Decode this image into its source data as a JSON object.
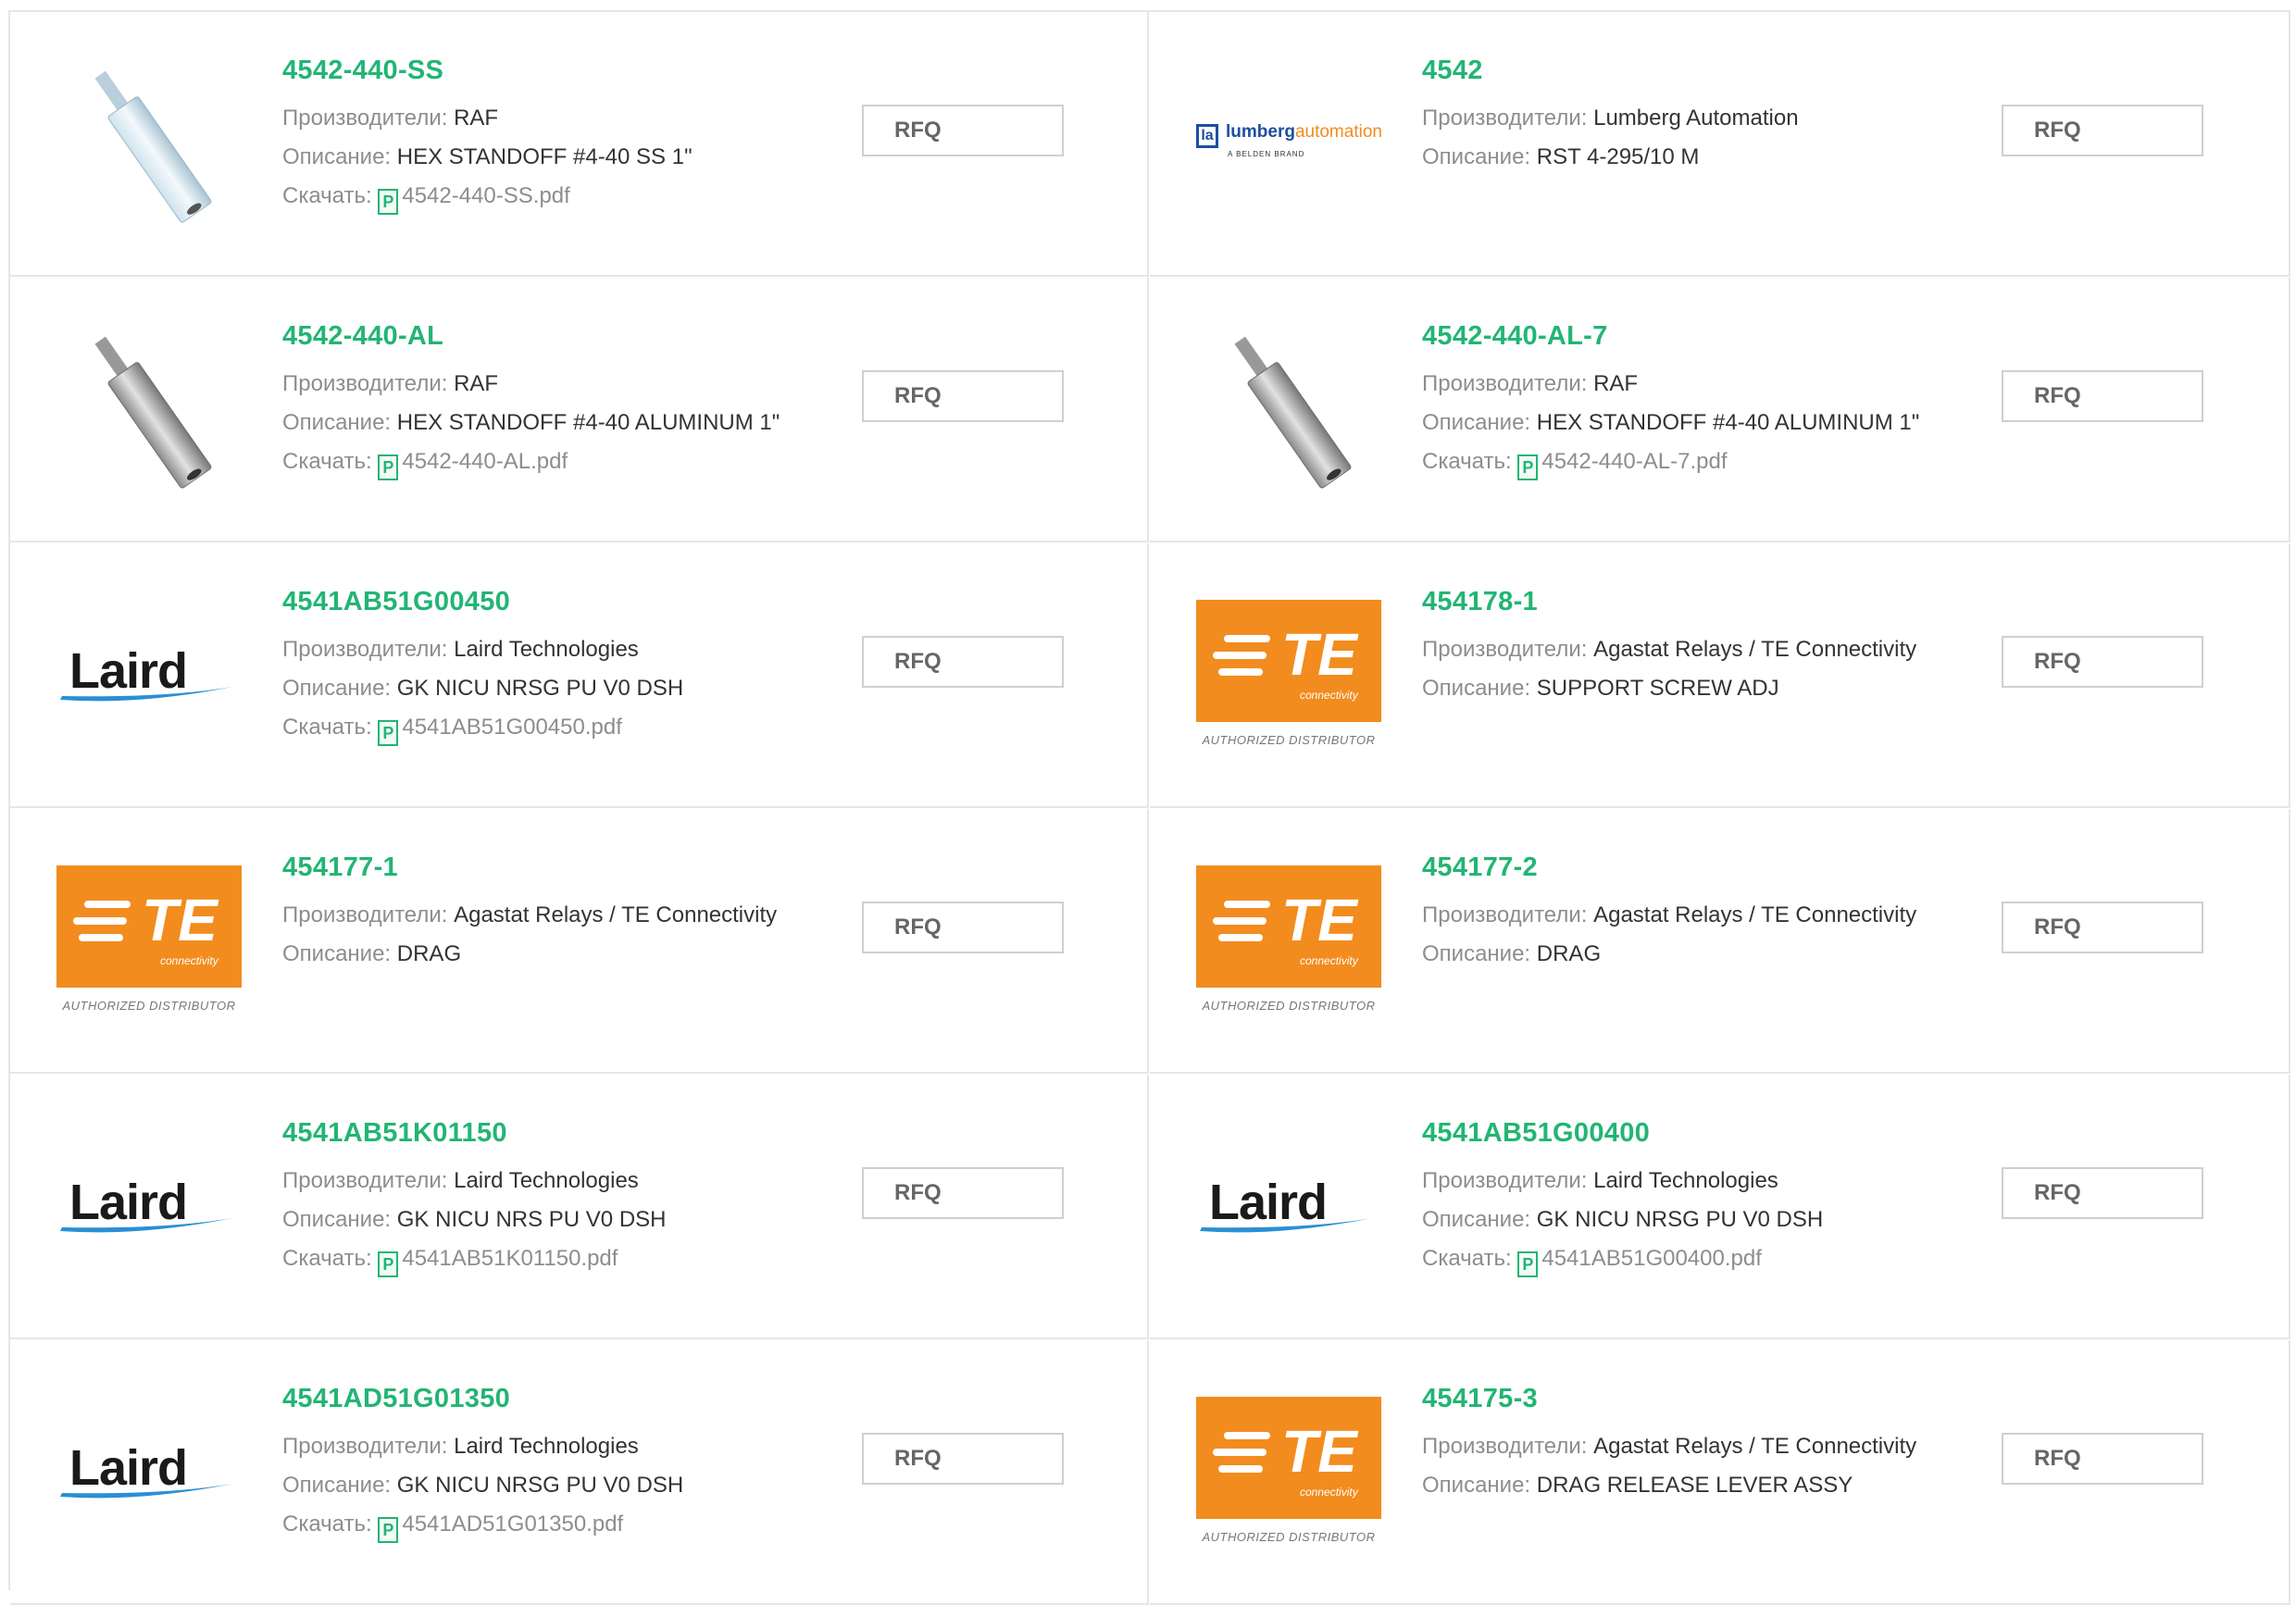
{
  "labels": {
    "manufacturer": "Производители:",
    "description": "Описание:",
    "download": "Скачать:",
    "rfq": "RFQ",
    "pdf_icon_glyph": "P"
  },
  "logos": {
    "laird": "Laird",
    "te": "TE",
    "te_sub": "connectivity",
    "te_authorized": "AUTHORIZED DISTRIBUTOR",
    "lumberg_main": "lumberg",
    "lumberg_accent": "automation",
    "lumberg_sub": "A BELDEN BRAND",
    "lumberg_mark": "la"
  },
  "colors": {
    "accent_green": "#22b573",
    "te_orange": "#f28c1e",
    "lumberg_blue": "#1d4e9e",
    "laird_blue": "#2a8fd4"
  },
  "products": [
    {
      "part": "4542-440-SS",
      "manufacturer": "RAF",
      "description": "HEX STANDOFF #4-40 SS 1\"",
      "file": "4542-440-SS.pdf",
      "image": "standoff-ss-photo"
    },
    {
      "part": "4542",
      "manufacturer": "Lumberg Automation",
      "description": "RST 4-295/10 M",
      "file": null,
      "image": "lumberg-logo"
    },
    {
      "part": "4542-440-AL",
      "manufacturer": "RAF",
      "description": "HEX STANDOFF #4-40 ALUMINUM 1\"",
      "file": "4542-440-AL.pdf",
      "image": "standoff-al-photo"
    },
    {
      "part": "4542-440-AL-7",
      "manufacturer": "RAF",
      "description": "HEX STANDOFF #4-40 ALUMINUM 1\"",
      "file": "4542-440-AL-7.pdf",
      "image": "standoff-al-photo"
    },
    {
      "part": "4541AB51G00450",
      "manufacturer": "Laird Technologies",
      "description": "GK NICU NRSG PU V0 DSH",
      "file": "4541AB51G00450.pdf",
      "image": "laird-logo"
    },
    {
      "part": "454178-1",
      "manufacturer": "Agastat Relays / TE Connectivity",
      "description": "SUPPORT SCREW ADJ",
      "file": null,
      "image": "te-logo"
    },
    {
      "part": "454177-1",
      "manufacturer": "Agastat Relays / TE Connectivity",
      "description": "DRAG",
      "file": null,
      "image": "te-logo"
    },
    {
      "part": "454177-2",
      "manufacturer": "Agastat Relays / TE Connectivity",
      "description": "DRAG",
      "file": null,
      "image": "te-logo"
    },
    {
      "part": "4541AB51K01150",
      "manufacturer": "Laird Technologies",
      "description": "GK NICU NRS PU V0 DSH",
      "file": "4541AB51K01150.pdf",
      "image": "laird-logo"
    },
    {
      "part": "4541AB51G00400",
      "manufacturer": "Laird Technologies",
      "description": "GK NICU NRSG PU V0 DSH",
      "file": "4541AB51G00400.pdf",
      "image": "laird-logo"
    },
    {
      "part": "4541AD51G01350",
      "manufacturer": "Laird Technologies",
      "description": "GK NICU NRSG PU V0 DSH",
      "file": "4541AD51G01350.pdf",
      "image": "laird-logo"
    },
    {
      "part": "454175-3",
      "manufacturer": "Agastat Relays / TE Connectivity",
      "description": "DRAG RELEASE LEVER ASSY",
      "file": null,
      "image": "te-logo"
    }
  ]
}
